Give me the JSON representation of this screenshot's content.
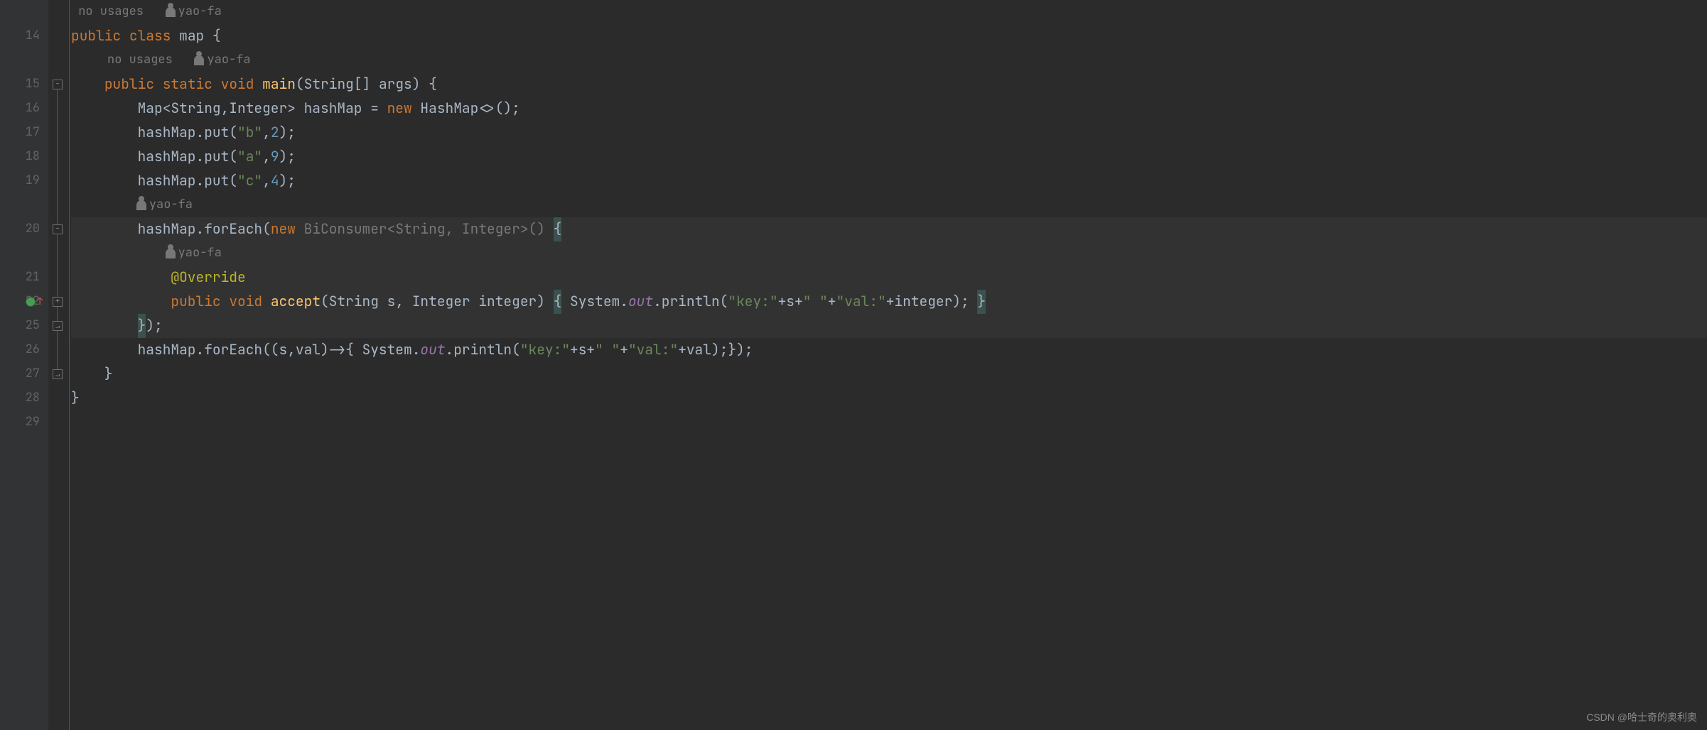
{
  "gutter": {
    "lines": [
      "",
      "14",
      "",
      "15",
      "16",
      "17",
      "18",
      "19",
      "",
      "20",
      "",
      "21",
      "22",
      "25",
      "26",
      "27",
      "28",
      "29"
    ]
  },
  "hints": {
    "no_usages": "no usages",
    "author": "yao-fa"
  },
  "code": {
    "l14": {
      "kw_public": "public",
      "kw_class": "class",
      "name": "map",
      "brace": " {"
    },
    "l15": {
      "kw_public": "public",
      "kw_static": "static",
      "kw_void": "void",
      "name": "main",
      "params": "(String[] args) {"
    },
    "l16": {
      "pre": "        Map<String,Integer> hashMap = ",
      "kw_new": "new",
      "post": " HashMap<>();"
    },
    "l17": {
      "pre": "        hashMap.put(",
      "str": "\"b\"",
      "mid": ",",
      "num": "2",
      "post": ");"
    },
    "l18": {
      "pre": "        hashMap.put(",
      "str": "\"a\"",
      "mid": ",",
      "num": "9",
      "post": ");"
    },
    "l19": {
      "pre": "        hashMap.put(",
      "str": "\"c\"",
      "mid": ",",
      "num": "4",
      "post": ");"
    },
    "l20": {
      "pre": "        hashMap.forEach(",
      "kw_new": "new",
      "mid": " BiConsumer<String, Integer>() ",
      "brace": "{"
    },
    "l21": {
      "ann": "@Override"
    },
    "l22": {
      "kw_public": "public",
      "kw_void": "void",
      "name": "accept",
      "params": "(String s, Integer integer) ",
      "b1": "{",
      "pre2": " System.",
      "out": "out",
      "mid2": ".println(",
      "s1": "\"key:\"",
      "p1": "+s+",
      "s2": "\" \"",
      "p2": "+",
      "s3": "\"val:\"",
      "p3": "+integer); ",
      "b2": "}"
    },
    "l25": {
      "b1": "}",
      "post": ");"
    },
    "l26": {
      "pre": "        hashMap.forEach((s,val)->{ System.",
      "out": "out",
      "mid": ".println(",
      "s1": "\"key:\"",
      "p1": "+s+",
      "s2": "\" \"",
      "p2": "+",
      "s3": "\"val:\"",
      "p3": "+val);});"
    },
    "l27": {
      "text": "    }"
    },
    "l28": {
      "text": "}"
    }
  },
  "watermark": "CSDN @哈士奇的奥利奥"
}
